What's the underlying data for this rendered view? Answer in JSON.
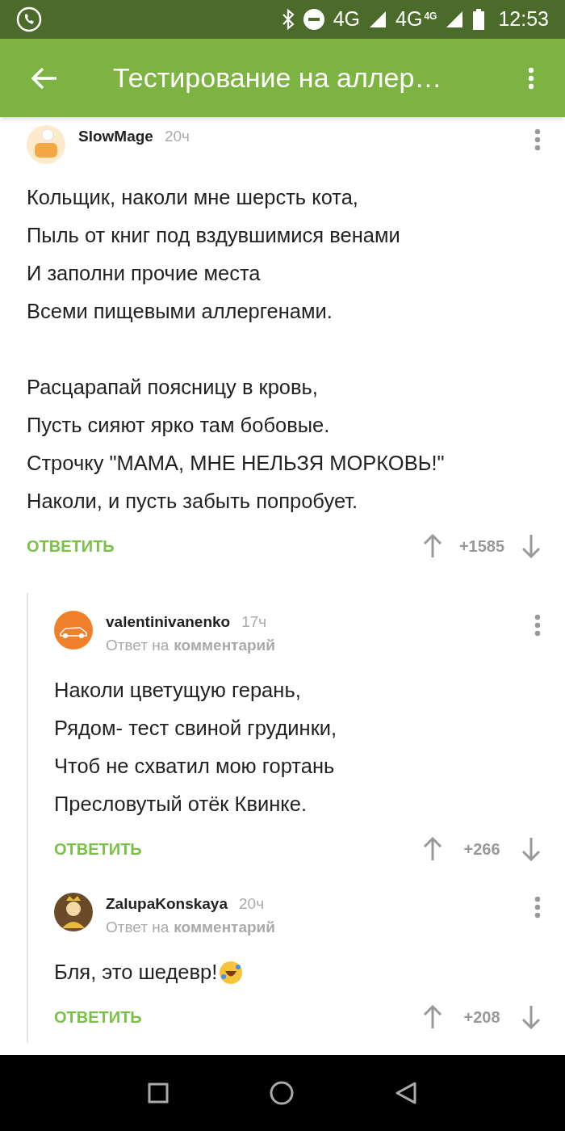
{
  "status_bar": {
    "network_1": "4G",
    "network_2": "4G",
    "network_2_badge": "4G",
    "time": "12:53"
  },
  "app_bar": {
    "title": "Тестирование на аллер…"
  },
  "comments": [
    {
      "author": "SlowMage",
      "time": "20ч",
      "stanzas": [
        [
          "Кольщик, наколи мне шерсть кота,",
          "Пыль от книг под вздувшимися венами",
          "И заполни прочие места",
          "Всеми пищевыми аллергенами."
        ],
        [
          "Расцарапай поясницу в кровь,",
          "Пусть сияют ярко там бобовые.",
          "Строчку \"МАМА, МНЕ НЕЛЬЗЯ МОРКОВЬ!\"",
          "Наколи, и пусть забыть попробует."
        ]
      ],
      "reply_label": "ОТВЕТИТЬ",
      "score": "+1585",
      "children": [
        {
          "author": "valentinivanenko",
          "time": "17ч",
          "reply_to": {
            "prefix": "Ответ на",
            "link": "комментарий"
          },
          "stanzas": [
            [
              "Наколи цветущую герань,",
              "Рядом- тест свиной грудинки,",
              "Чтоб не схватил мою гортань",
              "Пресловутый отёк Квинке."
            ]
          ],
          "reply_label": "ОТВЕТИТЬ",
          "score": "+266"
        },
        {
          "author": "ZalupaKonskaya",
          "time": "20ч",
          "reply_to": {
            "prefix": "Ответ на",
            "link": "комментарий"
          },
          "stanzas": [
            [
              "Бля, это шедевр!"
            ]
          ],
          "emoji": true,
          "reply_label": "ОТВЕТИТЬ",
          "score": "+208"
        }
      ]
    }
  ]
}
